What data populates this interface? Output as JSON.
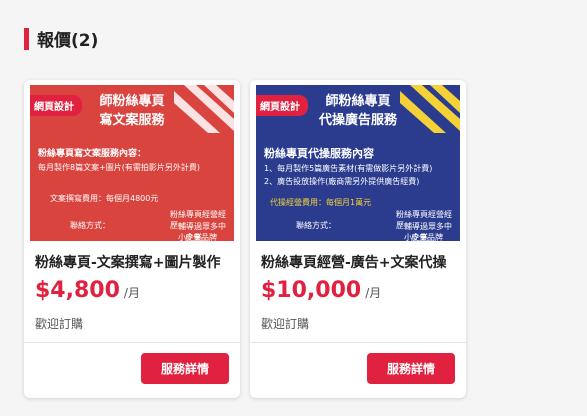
{
  "section": {
    "title": "報價(2)"
  },
  "cards": [
    {
      "tag": "網頁設計",
      "thumb_heading_1": "師粉絲專頁",
      "thumb_heading_2": "寫文案服務",
      "thumb_content_title": "粉絲專頁寫文案服務內容：",
      "thumb_content_line": "每月製作8篇文案+圖片(有需拍影片另外計費)",
      "thumb_fee": "文案撰寫費用：每個月4800元",
      "thumb_contact": "聯絡方式：",
      "thumb_experience": "粉絲專頁經營經歷：",
      "thumb_experience_detail": "輔導過眾多中小企業",
      "thumb_brand": "皮皇品牌FOCUS",
      "name": "粉絲專頁-文案撰寫+圖片製作",
      "price": "$4,800",
      "unit": "/月",
      "note": "歡迎訂購",
      "button": "服務詳情",
      "colors": {
        "thumb_bg": "#d9443f",
        "stripe": "#ffffff"
      }
    },
    {
      "tag": "網頁設計",
      "thumb_heading_1": "師粉絲專頁",
      "thumb_heading_2": "代操廣告服務",
      "thumb_content_title": "粉絲專頁代操服務內容",
      "thumb_content_line_1": "1、每月製作5篇廣告素材(有需做影片另外計費)",
      "thumb_content_line_2": "2、廣告投放操作(廠商需另外提供廣告經費)",
      "thumb_fee": "代操經營費用：每個月1萬元",
      "thumb_contact": "聯絡方式：",
      "thumb_experience": "粉絲專頁經營經歷：",
      "thumb_experience_detail": "輔導過眾多中小企業",
      "thumb_brand": "皮皇品牌FOCUS",
      "name": "粉絲專頁經營-廣告+文案代操",
      "price": "$10,000",
      "unit": "/月",
      "note": "歡迎訂購",
      "button": "服務詳情",
      "colors": {
        "thumb_bg": "#2b3c8f",
        "stripe": "#f4d237"
      }
    }
  ],
  "colors": {
    "accent": "#e0213f",
    "page_bg": "#f5f5f5"
  }
}
